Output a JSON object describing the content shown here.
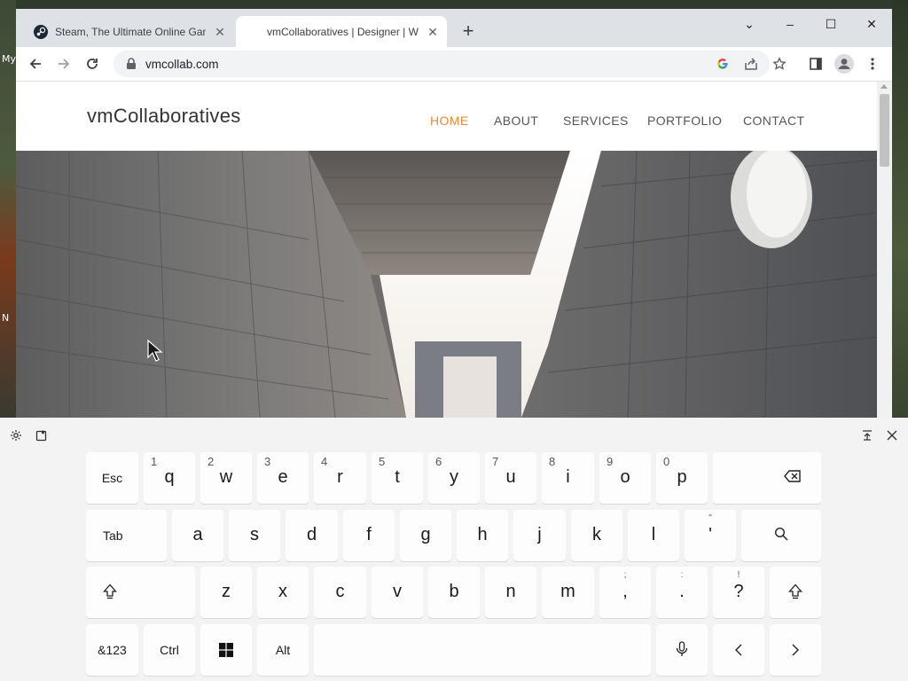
{
  "desktop": {
    "text_top": "My",
    "text_mid": "N"
  },
  "browser": {
    "tabs": [
      {
        "title": "Steam, The Ultimate Online Gam",
        "close": "✕"
      },
      {
        "title": "vmCollaboratives | Designer | We",
        "close": "✕"
      }
    ],
    "new_tab": "+",
    "window_controls": {
      "tab_search": "⌄",
      "minimize": "–",
      "maximize": "☐",
      "close": "✕"
    },
    "url": "vmcollab.com"
  },
  "site": {
    "logo": "vmCollaboratives",
    "nav": [
      "HOME",
      "ABOUT",
      "SERVICES",
      "PORTFOLIO",
      "CONTACT"
    ],
    "active_nav": "HOME",
    "accent_color": "#e08a3c"
  },
  "keyboard": {
    "row1": [
      {
        "label": "Esc"
      },
      {
        "main": "q",
        "hint": "1"
      },
      {
        "main": "w",
        "hint": "2"
      },
      {
        "main": "e",
        "hint": "3"
      },
      {
        "main": "r",
        "hint": "4"
      },
      {
        "main": "t",
        "hint": "5"
      },
      {
        "main": "y",
        "hint": "6"
      },
      {
        "main": "u",
        "hint": "7"
      },
      {
        "main": "i",
        "hint": "8"
      },
      {
        "main": "o",
        "hint": "9"
      },
      {
        "main": "p",
        "hint": "0"
      }
    ],
    "row2": [
      {
        "label": "Tab"
      },
      {
        "main": "a"
      },
      {
        "main": "s"
      },
      {
        "main": "d"
      },
      {
        "main": "f"
      },
      {
        "main": "g"
      },
      {
        "main": "h"
      },
      {
        "main": "j"
      },
      {
        "main": "k"
      },
      {
        "main": "l"
      },
      {
        "main": "'",
        "hint": "\""
      }
    ],
    "row3": [
      {
        "main": "z"
      },
      {
        "main": "x"
      },
      {
        "main": "c"
      },
      {
        "main": "v"
      },
      {
        "main": "b"
      },
      {
        "main": "n"
      },
      {
        "main": "m"
      },
      {
        "main": ",",
        "hint": ";"
      },
      {
        "main": ".",
        "hint": ":"
      },
      {
        "main": "?",
        "hint": "!"
      }
    ],
    "row4": {
      "symbols": "&123",
      "ctrl": "Ctrl",
      "alt": "Alt"
    }
  }
}
